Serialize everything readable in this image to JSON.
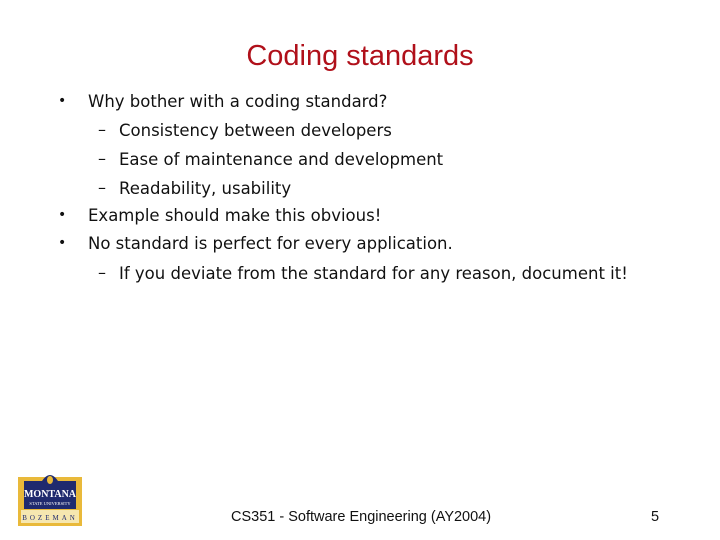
{
  "slide": {
    "title": "Coding standards",
    "bullets": [
      {
        "text": "Why bother with a coding standard?",
        "sub": [
          "Consistency between developers",
          "Ease of maintenance and development",
          "Readability, usability"
        ]
      },
      {
        "text": "Example should make this obvious!",
        "sub": []
      },
      {
        "text": "No standard is perfect for every application.",
        "sub": [
          "If you deviate from the standard for any reason, document it!"
        ]
      }
    ],
    "bullet_glyph": "•",
    "dash_glyph": "–",
    "footer": {
      "course": "CS351 - Software Engineering (AY2004)",
      "page_number": "5"
    },
    "logo": {
      "name": "montana-state-university-logo",
      "line1": "MONTANA",
      "line2": "STATE UNIVERSITY",
      "line3": "BOZEMAN",
      "colors": {
        "navy": "#1f2a6e",
        "gold": "#e9b93a",
        "cream": "#f6e7b0"
      }
    },
    "colors": {
      "title": "#b0101a",
      "text": "#111111"
    }
  }
}
